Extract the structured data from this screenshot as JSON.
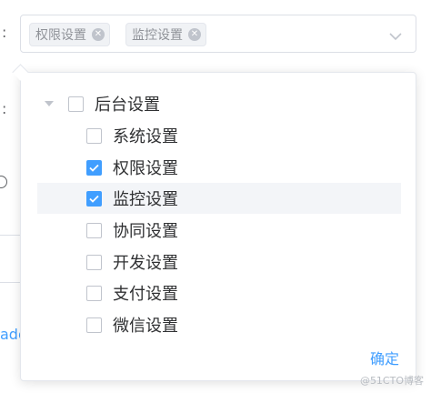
{
  "background": {
    "row1_colon": ":",
    "row2_colon": ":",
    "row3_fragment": "ado"
  },
  "select": {
    "tags": [
      {
        "label": "权限设置"
      },
      {
        "label": "监控设置"
      }
    ],
    "arrow_icon": "chevron-down-icon"
  },
  "tree": {
    "root": {
      "label": "后台设置",
      "expanded": true,
      "checked": false
    },
    "children": [
      {
        "label": "系统设置",
        "checked": false
      },
      {
        "label": "权限设置",
        "checked": true
      },
      {
        "label": "监控设置",
        "checked": true,
        "highlighted": true
      },
      {
        "label": "协同设置",
        "checked": false
      },
      {
        "label": "开发设置",
        "checked": false
      },
      {
        "label": "支付设置",
        "checked": false
      },
      {
        "label": "微信设置",
        "checked": false
      }
    ]
  },
  "confirm_label": "确定",
  "watermark": "@51CTO博客",
  "colors": {
    "primary": "#409eff",
    "border": "#dcdfe6",
    "tag_bg": "#f0f2f5",
    "text": "#303133",
    "highlight": "#f3f5f8"
  }
}
